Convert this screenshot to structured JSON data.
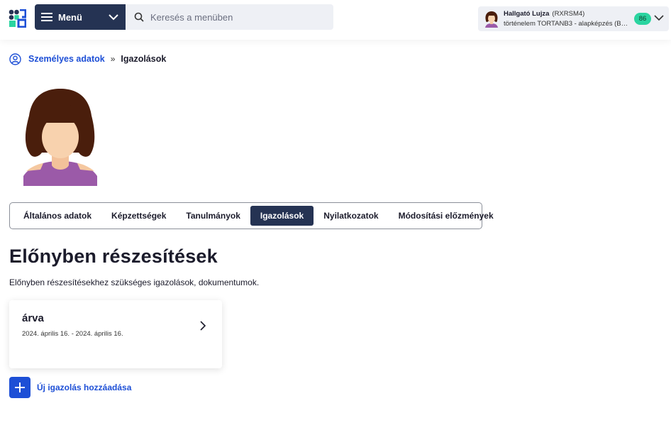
{
  "header": {
    "menu_label": "Menü",
    "search_placeholder": "Keresés a menüben",
    "user": {
      "name": "Hallgató Lujza",
      "code": "(RXRSM4)",
      "program": "történelem TORTANB3 - alapképzés (BA/...",
      "badge": "86"
    }
  },
  "breadcrumb": {
    "link": "Személyes adatok",
    "separator": "»",
    "current": "Igazolások"
  },
  "tabs": [
    {
      "label": "Általános adatok",
      "active": false
    },
    {
      "label": "Képzettségek",
      "active": false
    },
    {
      "label": "Tanulmányok",
      "active": false
    },
    {
      "label": "Igazolások",
      "active": true
    },
    {
      "label": "Nyilatkozatok",
      "active": false
    },
    {
      "label": "Módosítási előzmények",
      "active": false
    }
  ],
  "section": {
    "title": "Előnyben részesítések",
    "description": "Előnyben részesítésekhez szükséges igazolások, dokumentumok."
  },
  "card": {
    "title": "árva",
    "date_range": "2024. április 16. - 2024. április 16."
  },
  "add_button": {
    "label": "Új igazolás hozzáadása"
  },
  "icons": {
    "logo": "neptun-logo-icon",
    "menu": "hamburger-icon",
    "search": "search-icon",
    "breadcrumb": "user-circle-icon",
    "card": "chevron-right-icon",
    "add": "plus-icon"
  },
  "colors": {
    "navy": "#253353",
    "accent_blue": "#1d4fd6",
    "badge_green": "#2ad4a0"
  }
}
